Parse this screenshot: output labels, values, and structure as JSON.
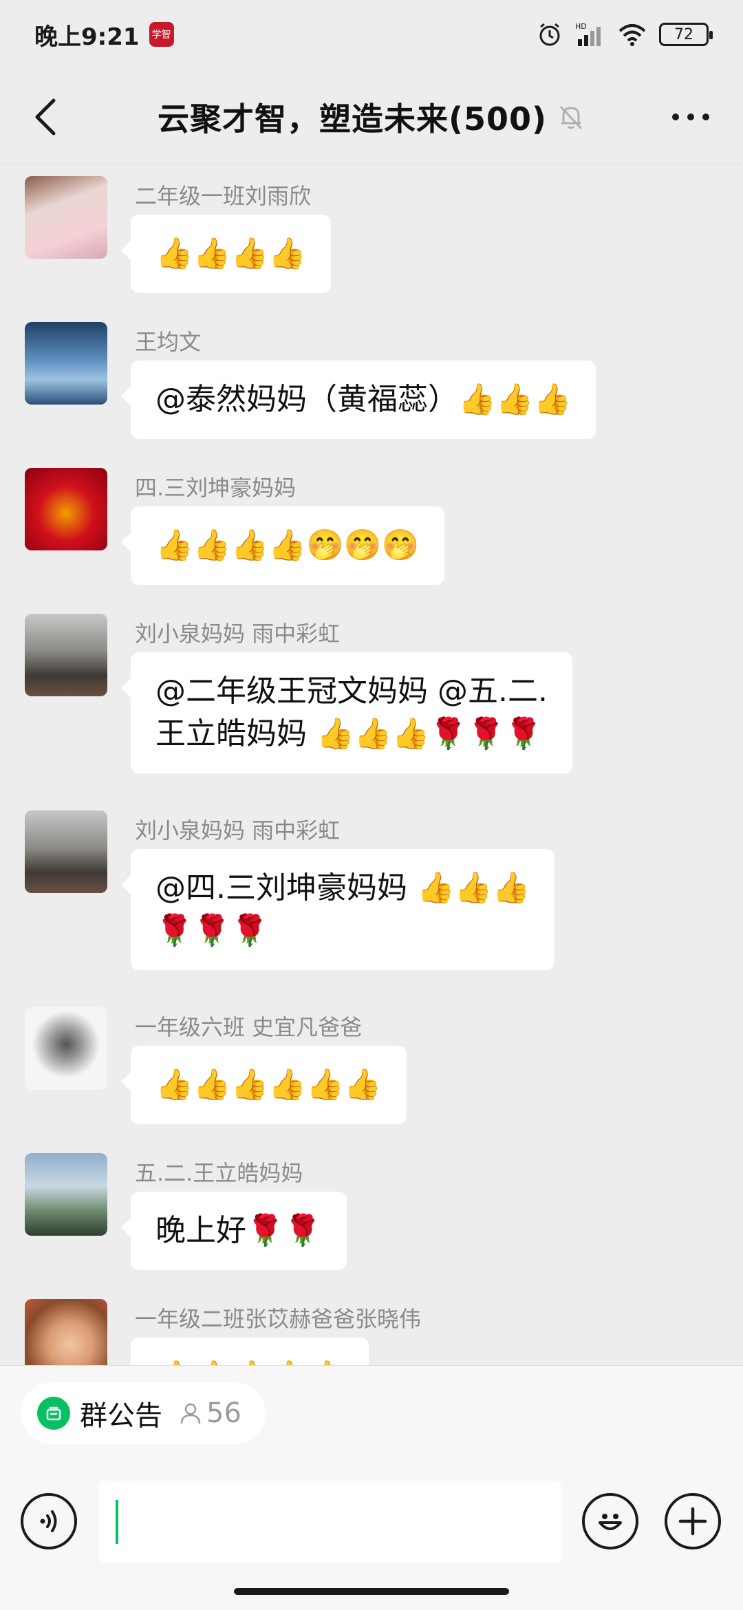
{
  "status_bar": {
    "time": "晚上9:21",
    "app_icon_text": "学智",
    "hd_label": "HD",
    "battery": "72"
  },
  "header": {
    "title": "云聚才智，塑造未来(500)",
    "muted": true
  },
  "messages": [
    {
      "sender": "二年级一班刘雨欣",
      "lines": [
        "👍👍👍👍"
      ],
      "avatar_color": "#d9b7b9"
    },
    {
      "sender": "王均文",
      "lines": [
        "@泰然妈妈（黄福蕊）👍👍👍"
      ],
      "avatar_color": "#4b78a6"
    },
    {
      "sender": "四.三刘坤豪妈妈",
      "lines": [
        "👍👍👍👍🤭🤭🤭"
      ],
      "avatar_color": "#c0111f"
    },
    {
      "sender": "刘小泉妈妈  雨中彩虹",
      "lines": [
        "@二年级王冠文妈妈 @五.二.",
        "王立皓妈妈 👍👍👍🌹🌹🌹"
      ],
      "avatar_color": "#6b6560"
    },
    {
      "sender": "刘小泉妈妈  雨中彩虹",
      "lines": [
        "@四.三刘坤豪妈妈 👍👍👍",
        "🌹🌹🌹"
      ],
      "avatar_color": "#6b6560"
    },
    {
      "sender": "一年级六班 史宜凡爸爸",
      "lines": [
        "👍👍👍👍👍👍"
      ],
      "avatar_color": "#f2f2f2"
    },
    {
      "sender": "五.二.王立皓妈妈",
      "lines": [
        "晚上好🌹🌹"
      ],
      "avatar_color": "#5c7f9a"
    },
    {
      "sender": "一年级二班张苡赫爸爸张晓伟",
      "lines": [
        "👍👍👍👍👍"
      ],
      "avatar_color": "#c98f6d"
    }
  ],
  "notice": {
    "label": "群公告",
    "count": "56"
  },
  "input": {
    "value": "",
    "placeholder": ""
  },
  "icons": {
    "back": "chevron-left-icon",
    "mute": "bell-muted-icon",
    "more": "more-dots-icon",
    "voice": "voice-icon",
    "emoji": "emoji-icon",
    "add": "plus-icon"
  },
  "colors": {
    "accent": "#07c160",
    "background": "#ededed",
    "bubble": "#ffffff"
  }
}
